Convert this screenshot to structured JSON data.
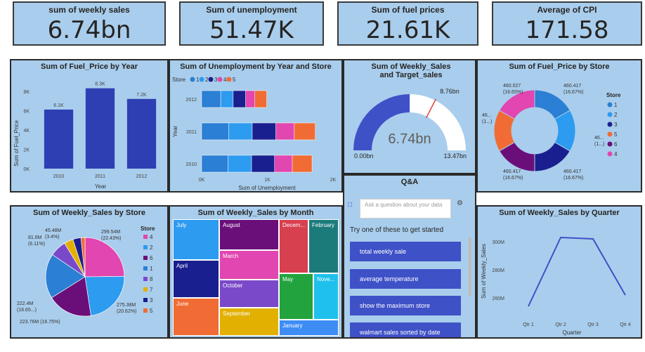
{
  "cards": [
    {
      "title": "sum of weekly sales",
      "value": "6.74bn"
    },
    {
      "title": "Sum of unemployment",
      "value": "51.47K"
    },
    {
      "title": "Sum of fuel prices",
      "value": "21.61K"
    },
    {
      "title": "Average of CPI",
      "value": "171.58"
    }
  ],
  "colors": {
    "panel_bg": "#a9cdec",
    "bar_blue": "#2e3fb4",
    "store1": "#2b7fd4",
    "store2": "#2d9bf0",
    "store3": "#1a1f8f",
    "store4": "#e246b0",
    "store5": "#f06c34",
    "store6": "#6a0f7a",
    "accent": "#3f51c7"
  },
  "fuel_year": {
    "title": "Sum of Fuel_Price by Year",
    "xlabel": "Year",
    "ylabel": "Sum of Fuel_Price",
    "ticks_y": [
      "0K",
      "2K",
      "4K",
      "6K",
      "8K"
    ],
    "chart_data": {
      "type": "bar",
      "categories": [
        "2010",
        "2011",
        "2012"
      ],
      "values": [
        6100,
        8300,
        7200
      ],
      "labels": [
        "6.1K",
        "8.3K",
        "7.2K"
      ],
      "ylim": [
        0,
        9000
      ]
    }
  },
  "unemp": {
    "title": "Sum of Unemployment by Year and Store",
    "legend_title": "Store",
    "legend": [
      "1",
      "2",
      "3",
      "4",
      "5"
    ],
    "xlabel": "Sum of Unemployment",
    "ylabel": "Year",
    "ticks_x": [
      "0K",
      "1K",
      "2K"
    ],
    "chart_data": {
      "type": "bar",
      "categories": [
        "2012",
        "2011",
        "2010"
      ],
      "series": [
        {
          "name": "1",
          "values": [
            290,
            410,
            400
          ]
        },
        {
          "name": "2",
          "values": [
            190,
            360,
            360
          ]
        },
        {
          "name": "3",
          "values": [
            190,
            360,
            350
          ]
        },
        {
          "name": "4",
          "values": [
            140,
            280,
            270
          ]
        },
        {
          "name": "5",
          "values": [
            180,
            320,
            300
          ]
        }
      ],
      "xlim": [
        0,
        2000
      ]
    }
  },
  "gauge": {
    "title": "Sum of Weekly_Sales and Target_sales",
    "value": "6.74bn",
    "min": "0.00bn",
    "max": "13.47bn",
    "target": "8.76bn",
    "chart_data": {
      "type": "gauge",
      "value": 6.74,
      "min": 0,
      "max": 13.47,
      "target": 8.76
    }
  },
  "donut": {
    "title": "Sum of Fuel_Price by Store",
    "legend_title": "Store",
    "legend": [
      "1",
      "2",
      "3",
      "5",
      "6",
      "4"
    ],
    "labels": {
      "tl": [
        "460.027",
        "(16.65%)"
      ],
      "tr": [
        "460.417",
        "(16.67%)"
      ],
      "l": [
        "46...",
        "(1...)"
      ],
      "r": [
        "46...",
        "(1...)"
      ],
      "bl": [
        "460.417",
        "(16.67%)"
      ],
      "br": [
        "460.417",
        "(16.67%)"
      ]
    },
    "chart_data": {
      "type": "pie",
      "categories": [
        "1",
        "2",
        "3",
        "6",
        "5",
        "4"
      ],
      "values": [
        460.4,
        460.4,
        460.4,
        460.4,
        460.0,
        460.4
      ]
    }
  },
  "pie": {
    "title": "Sum of Weekly_Sales by Store",
    "legend_title": "Store",
    "legend": [
      "4",
      "2",
      "6",
      "1",
      "8",
      "7",
      "3",
      "5"
    ],
    "labels": {
      "a": [
        "299.54M",
        "(22.43%)"
      ],
      "b": [
        "275.38M",
        "(20.62%)"
      ],
      "c": [
        "223.76M (16.75%)"
      ],
      "d": [
        "222.4M",
        "(16.65...)"
      ],
      "e": [
        "81.6M",
        "(6.11%)"
      ],
      "f": [
        "45.48M",
        "(3.4%)"
      ]
    },
    "chart_data": {
      "type": "pie",
      "categories": [
        "4",
        "2",
        "6",
        "1",
        "8",
        "7",
        "3",
        "5"
      ],
      "values": [
        299.54,
        275.38,
        223.76,
        222.4,
        81.6,
        45.48,
        40.0,
        20.0
      ]
    }
  },
  "treemap": {
    "title": "Sum of Weekly_Sales by Month",
    "cells": [
      "July",
      "August",
      "Decem...",
      "February",
      "March",
      "April",
      "October",
      "May",
      "Nove...",
      "June",
      "September",
      "January"
    ]
  },
  "qa": {
    "title": "Q&A",
    "placeholder": "Ask a question about your data",
    "hint": "Try one of these to get started",
    "suggestions": [
      "total weekly sale",
      "average temperature",
      "show the maximum store",
      "walmart sales sorted by date"
    ]
  },
  "quarter": {
    "title": "Sum of Weekly_Sales by Quarter",
    "xlabel": "Quarter",
    "ylabel": "Sum of Weekly_Sales",
    "ticks_y": [
      "260M",
      "280M",
      "300M"
    ],
    "chart_data": {
      "type": "line",
      "categories": [
        "Qtr 1",
        "Qtr 2",
        "Qtr 3",
        "Qtr 4"
      ],
      "values": [
        254,
        303,
        302,
        262
      ],
      "ylim": [
        250,
        310
      ]
    }
  }
}
